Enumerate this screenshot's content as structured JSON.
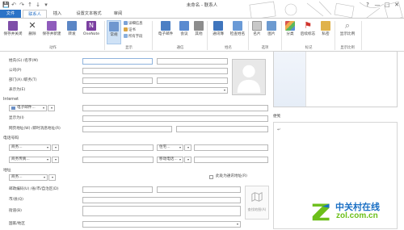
{
  "window": {
    "title": "未命名 - 联系人",
    "help": "?",
    "minimize": "—",
    "maximize": "□",
    "close": "✕"
  },
  "qat": [
    "💾",
    "↶",
    "↷",
    "↑",
    "↓",
    "▾"
  ],
  "tabs": [
    "文件",
    "联系人",
    "插入",
    "设置文本格式",
    "审阅"
  ],
  "ribbon": {
    "actions": {
      "save_close": "保存并关闭",
      "delete": "删除",
      "save_new": "保存并新建",
      "forward": "转发",
      "onenote": "OneNote",
      "label": "动作"
    },
    "show": {
      "general": "常规",
      "details": "详细信息",
      "certificates": "证书",
      "all_fields": "所有字段",
      "label": "显示"
    },
    "communicate": {
      "email": "电子邮件",
      "meeting": "会议",
      "more": "其他",
      "label": "通信"
    },
    "names": {
      "address_book": "通讯簿",
      "check_names": "检查姓名",
      "label": "姓名"
    },
    "options": {
      "business_card": "名片",
      "picture": "图片",
      "label": "选项"
    },
    "tags": {
      "categorize": "分类",
      "follow_up": "后续标志",
      "private": "私密",
      "label": "标记"
    },
    "zoom": {
      "zoom": "显示比例",
      "label": "显示比例"
    }
  },
  "form": {
    "name_label": "姓氏(G) /名字(M)",
    "company_label": "公司(P)",
    "department_label": "部门(A) /职务(T)",
    "file_as_label": "表示为(E)",
    "internet_label": "Internet",
    "email_dropdown": "电子邮件...",
    "display_as_label": "显示为(I)",
    "webpage_label": "网页地址(W) /即时消息地址(R)",
    "phone_label": "电话号码",
    "business_phone": "商务...",
    "home_phone": "住宅...",
    "business_fax": "商务传真...",
    "mobile_phone": "移动电话...",
    "address_label": "地址",
    "address_type": "商务...",
    "mailing_address_label": "此处为通讯地址(R)",
    "postal_label": "邮政编码(U) /省/市/自治区(D)",
    "city_label": "市/县(Q)",
    "street_label": "街道(B)",
    "country_label": "国家/地区",
    "map_button": "查找地图(A)",
    "notes_label": "便笺"
  },
  "watermark": {
    "cn": "中关村在线",
    "url": "zol.com.cn"
  },
  "colors": {
    "accent": "#2b73c7",
    "watermark_green": "#6cbf1a",
    "watermark_blue": "#1a6fc4"
  }
}
